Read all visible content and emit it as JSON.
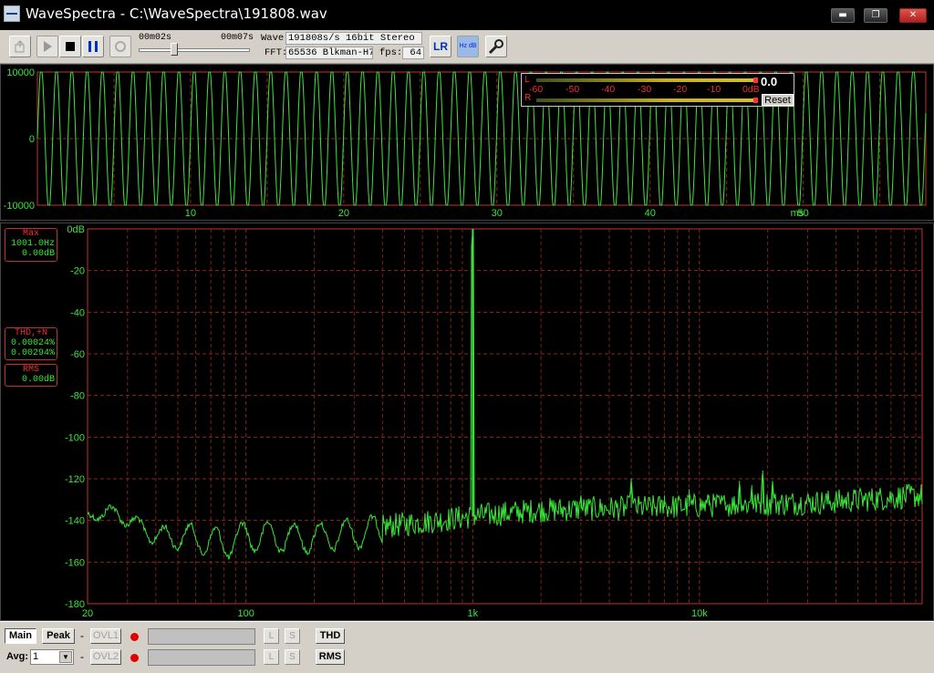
{
  "window": {
    "title": "WaveSpectra - C:\\WaveSpectra\\191808.wav",
    "min_glyph": "▬",
    "max_glyph": "❐",
    "close_glyph": "✕"
  },
  "toolbar": {
    "position_current": "00m02s",
    "position_total": "00m07s",
    "seek_fraction": 0.3,
    "wave_label": "Wave:",
    "wave_value": "191808s/s 16bit Stereo",
    "fft_label": "FFT:",
    "fft_value": "65536 Blkman-H7",
    "fps_label": "fps:",
    "fps_value": "64",
    "lr_label": "LR",
    "hzdb_label": "Hz dB",
    "icons": [
      "record-settings-icon",
      "play-icon",
      "stop-icon",
      "pause-icon",
      "loop-icon",
      "lr-channel-icon",
      "hz-db-icon",
      "wrench-icon"
    ]
  },
  "level_meter": {
    "left_channel": "L",
    "right_channel": "R",
    "ticks": [
      "-60",
      "-50",
      "-40",
      "-30",
      "-20",
      "-10",
      "0dB"
    ],
    "readout": "0.0",
    "reset_label": "Reset"
  },
  "readouts": {
    "max": {
      "title": "Max",
      "freq": "1001.0Hz",
      "level": "0.00dB"
    },
    "thd": {
      "title": "THD,+N",
      "thd": "0.00024%",
      "thdn": "0.00294%"
    },
    "rms": {
      "title": "RMS",
      "level": "0.00dB"
    }
  },
  "chart_data": [
    {
      "type": "line",
      "title": "",
      "xlabel": "ms",
      "ylabel": "",
      "xlim": [
        0,
        58
      ],
      "ylim": [
        -10000,
        10000
      ],
      "x_ticks": [
        "10",
        "20",
        "30",
        "40",
        "50"
      ],
      "y_ticks": [
        "10000",
        "0",
        "-10000"
      ],
      "signal": {
        "frequency_hz": 1001,
        "amplitude": 10000
      },
      "grid": true,
      "line_color": "#39e639"
    },
    {
      "type": "line",
      "title": "",
      "xlabel": "",
      "ylabel": "",
      "x_scale": "log",
      "xlim": [
        20,
        96000
      ],
      "ylim": [
        -180,
        0
      ],
      "x_ticks": [
        "20",
        "100",
        "1k",
        "10k"
      ],
      "y_ticks": [
        "0dB",
        "-20",
        "-40",
        "-60",
        "-80",
        "-100",
        "-120",
        "-140",
        "-160",
        "-180"
      ],
      "grid": true,
      "line_color": "#39e639",
      "peaks": [
        {
          "freq": 1001,
          "level": 0
        },
        {
          "freq": 3003,
          "level": -128
        },
        {
          "freq": 5005,
          "level": -120
        },
        {
          "freq": 7007,
          "level": -128
        },
        {
          "freq": 9009,
          "level": -125
        },
        {
          "freq": 11011,
          "level": -128
        },
        {
          "freq": 13013,
          "level": -131
        },
        {
          "freq": 15015,
          "level": -121
        },
        {
          "freq": 17017,
          "level": -123
        },
        {
          "freq": 19019,
          "level": -116
        },
        {
          "freq": 21021,
          "level": -121
        }
      ],
      "noise_floor": [
        {
          "freq": 20,
          "level": -137
        },
        {
          "freq": 25,
          "level": -134
        },
        {
          "freq": 30,
          "level": -138
        },
        {
          "freq": 40,
          "level": -146
        },
        {
          "freq": 60,
          "level": -147
        },
        {
          "freq": 80,
          "level": -150
        },
        {
          "freq": 100,
          "level": -146
        },
        {
          "freq": 200,
          "level": -147
        },
        {
          "freq": 400,
          "level": -143
        },
        {
          "freq": 700,
          "level": -140
        },
        {
          "freq": 1000,
          "level": -138
        },
        {
          "freq": 2000,
          "level": -135
        },
        {
          "freq": 5000,
          "level": -134
        },
        {
          "freq": 10000,
          "level": -133
        },
        {
          "freq": 20000,
          "level": -132
        },
        {
          "freq": 40000,
          "level": -131
        },
        {
          "freq": 96000,
          "level": -128
        }
      ]
    }
  ],
  "bottom": {
    "main_label": "Main",
    "peak_label": "Peak",
    "avg_label": "Avg:",
    "avg_value": "1",
    "dash": "-",
    "ovl1_label": "OVL1",
    "ovl2_label": "OVL2",
    "l_label": "L",
    "s_label": "S",
    "thd_label": "THD",
    "rms_label": "RMS"
  }
}
